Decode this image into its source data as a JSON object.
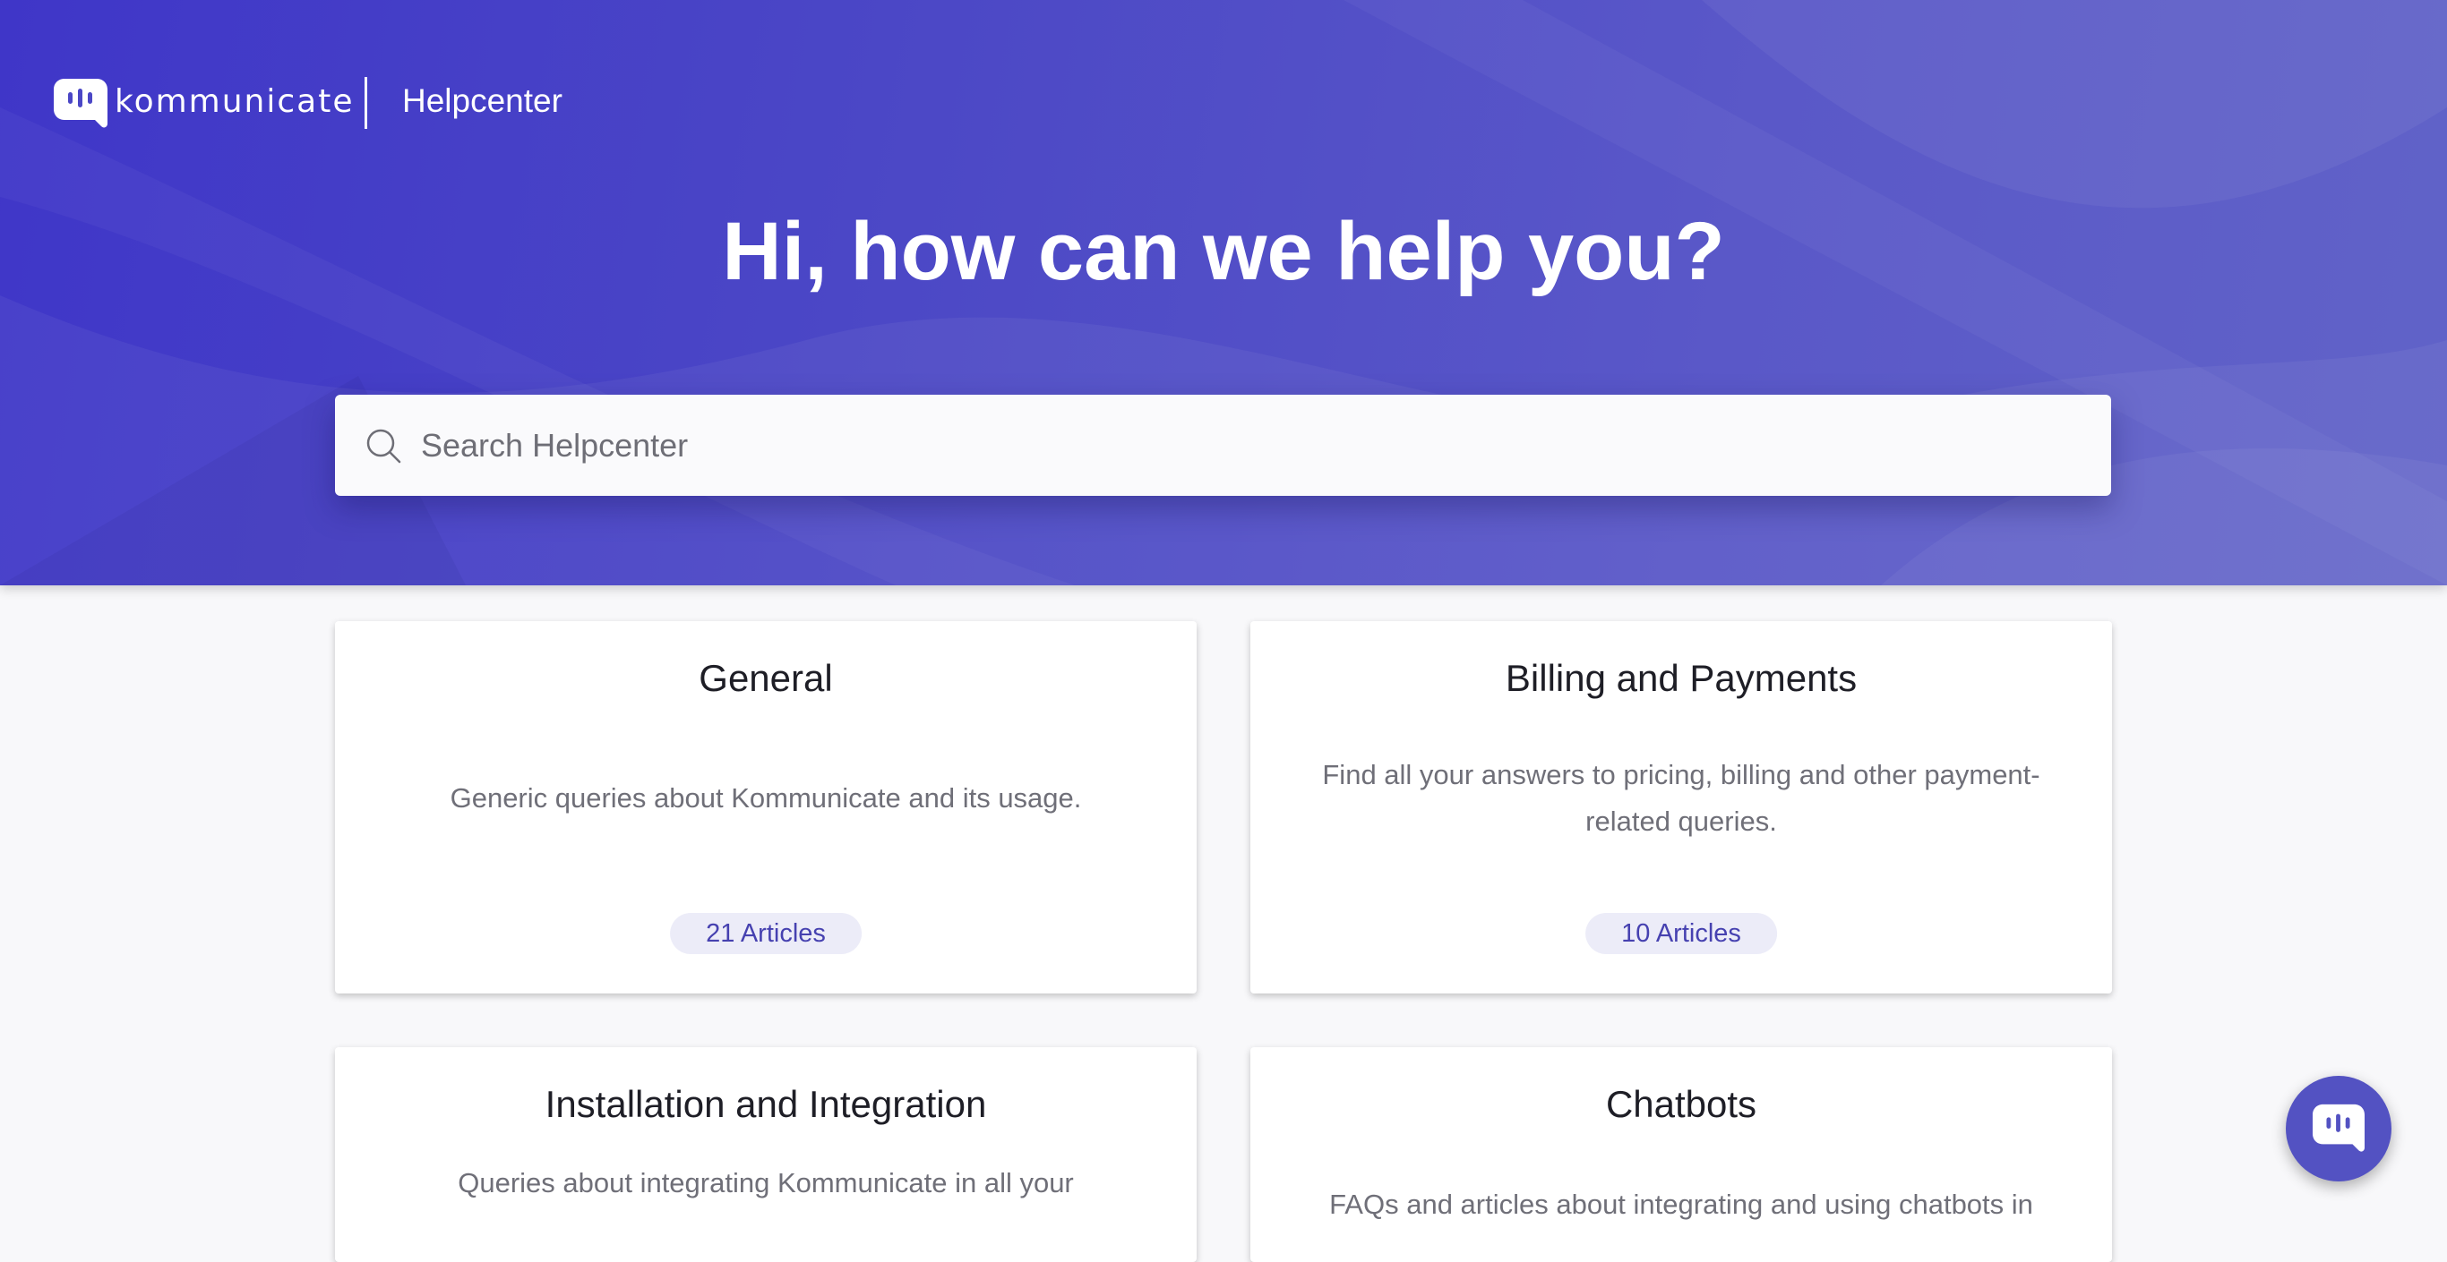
{
  "brand": {
    "logo_text": "kommunicate",
    "section_label": "Helpcenter"
  },
  "hero": {
    "headline": "Hi, how can we help you?"
  },
  "search": {
    "placeholder": "Search Helpcenter",
    "value": ""
  },
  "categories": [
    {
      "title": "General",
      "description": "Generic queries about Kommunicate and its usage.",
      "articles": "21 Articles"
    },
    {
      "title": "Billing and Payments",
      "description": "Find all your answers to pricing, billing and other payment-related queries.",
      "articles": "10 Articles"
    },
    {
      "title": "Installation and Integration",
      "description": "Queries about integrating Kommunicate in all your"
    },
    {
      "title": "Chatbots",
      "description": "FAQs and articles about integrating and using chatbots in"
    }
  ],
  "icons": {
    "logo": "kommunicate-logo-icon",
    "search": "search-icon",
    "chat": "chat-bubble-icon"
  },
  "colors": {
    "hero_background": "#4b47c6",
    "accent": "#5352c2",
    "badge_background": "#ececf8",
    "badge_text": "#4641b0"
  }
}
